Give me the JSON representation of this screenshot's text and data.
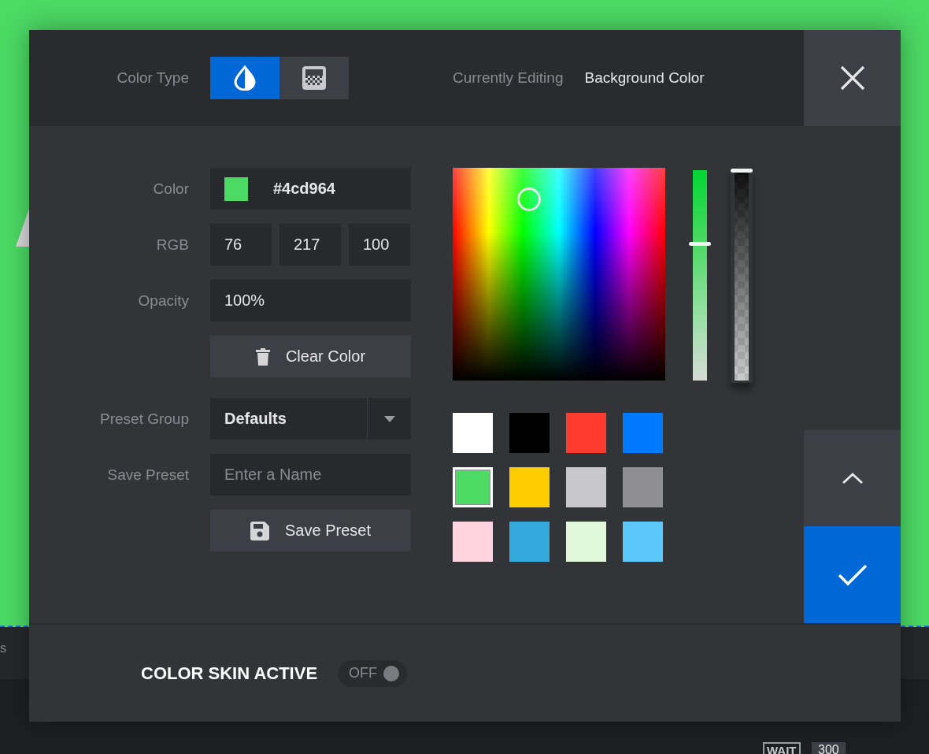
{
  "background": {
    "texts": [
      {
        "kind": "side",
        "text": "s"
      },
      {
        "kind": "tag",
        "text": "WAIT"
      },
      {
        "kind": "value",
        "text": "300"
      }
    ]
  },
  "header": {
    "color_type_label": "Color Type",
    "color_types": [
      {
        "kind": "solid",
        "selected": true
      },
      {
        "kind": "gradient",
        "selected": false
      }
    ],
    "editing_label": "Currently Editing",
    "editing_value": "Background Color"
  },
  "form": {
    "color_label": "Color",
    "color_value": "#4cd964",
    "rgb_label": "RGB",
    "rgb_values": [
      "76",
      "217",
      "100"
    ],
    "opacity_label": "Opacity",
    "opacity_value": "100%",
    "clear_button": "Clear Color",
    "preset_group_label": "Preset Group",
    "preset_group_value": "Defaults",
    "save_preset_label": "Save Preset",
    "save_preset_placeholder": "Enter a Name",
    "save_button": "Save Preset"
  },
  "sliders": [
    {
      "kind": "hue",
      "level": 0.65
    },
    {
      "kind": "alpha",
      "level": 1
    }
  ],
  "swatches": [
    {
      "color": "#ffffff",
      "selected": false
    },
    {
      "color": "#000000",
      "selected": false
    },
    {
      "color": "#ff3b30",
      "selected": false
    },
    {
      "color": "#007aff",
      "selected": false
    },
    {
      "color": "#4cd964",
      "selected": true
    },
    {
      "color": "#ffcc00",
      "selected": false
    },
    {
      "color": "#c7c7cc",
      "selected": false
    },
    {
      "color": "#8e8e93",
      "selected": false
    },
    {
      "color": "#ffd3e0",
      "selected": false
    },
    {
      "color": "#34aadc",
      "selected": false
    },
    {
      "color": "#e0f8d8",
      "selected": false
    },
    {
      "color": "#5ac8fa",
      "selected": false
    }
  ],
  "footer": {
    "label": "COLOR SKIN ACTIVE",
    "toggle": {
      "label": "OFF",
      "on": false
    }
  }
}
